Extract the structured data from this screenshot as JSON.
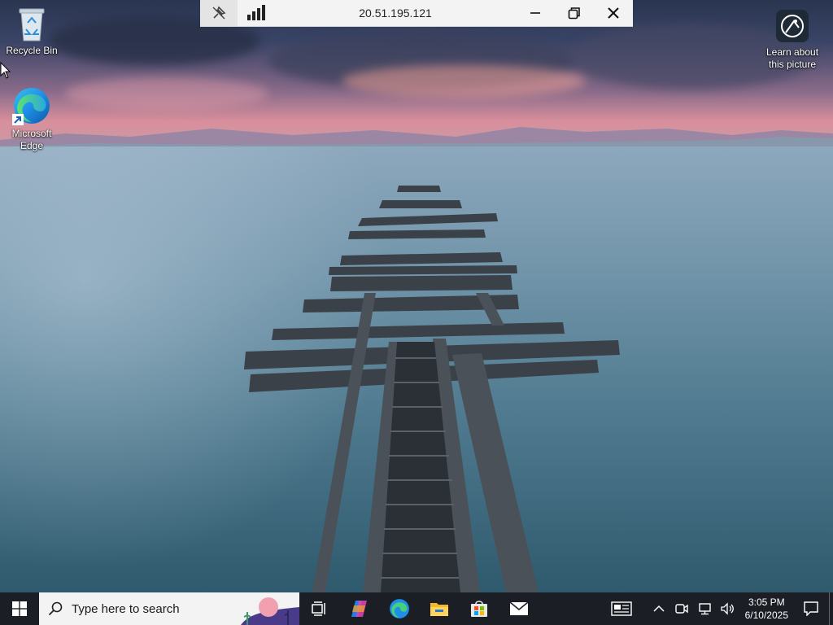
{
  "remote_bar": {
    "title": "20.51.195.121",
    "pin_icon": "pin-icon",
    "signal_icon": "connection-signal-icon",
    "minimize_icon": "minimize-icon",
    "restore_icon": "restore-icon",
    "close_icon": "close-icon"
  },
  "desktop": {
    "icons": [
      {
        "label": "Recycle Bin",
        "icon": "recycle-bin-icon"
      },
      {
        "label": "Microsoft Edge",
        "icon": "edge-icon"
      },
      {
        "label": "Learn about this picture",
        "icon": "learn-picture-icon"
      }
    ]
  },
  "taskbar": {
    "search_placeholder": "Type here to search",
    "pinned": [
      "task-view-icon",
      "copilot-icon",
      "edge-icon",
      "file-explorer-icon",
      "store-icon",
      "mail-icon"
    ],
    "tray": [
      "news-icon",
      "chevron-up-icon",
      "meet-icon",
      "network-icon",
      "volume-icon"
    ],
    "time": "3:05 PM",
    "date": "6/10/2025"
  },
  "colors": {
    "taskbar_bg": "#1c1e26",
    "remote_bar_bg": "#f3f3f3",
    "search_bg": "#f3f3f3",
    "windows_blue": "#0078d4"
  }
}
